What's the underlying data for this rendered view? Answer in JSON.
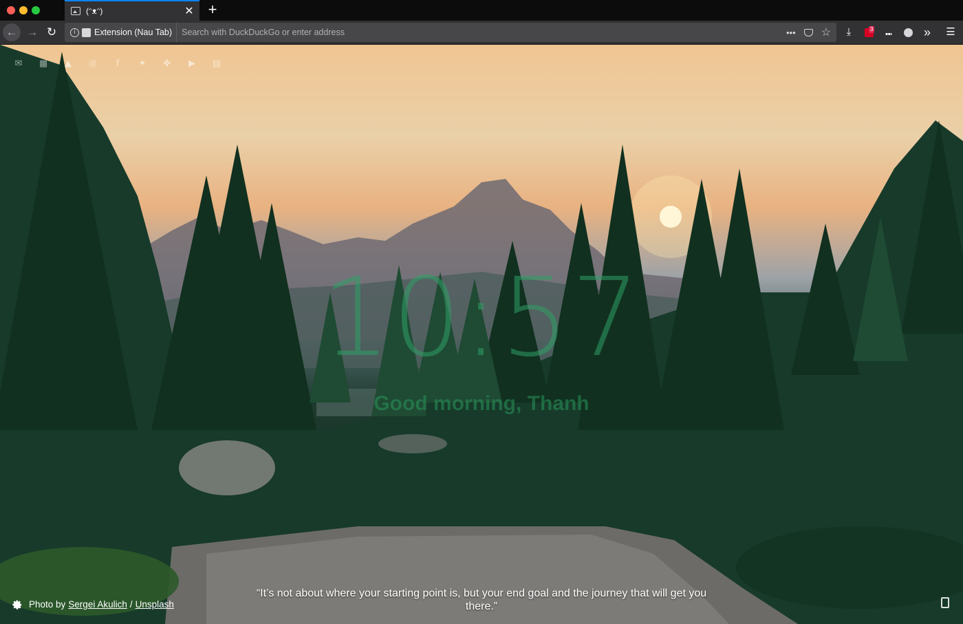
{
  "tab": {
    "title": "(ᵔᴥᵔ)",
    "close_symbol": "✕",
    "new_tab_symbol": "+"
  },
  "navbar": {
    "identity_label": "Extension (Nau Tab)",
    "url_placeholder": "Search with DuckDuckGo or enter address",
    "page_actions_symbol": "•••",
    "bookmark_symbol": "☆",
    "download_symbol": "⤓",
    "extension_badge": "3",
    "library_symbol": "⑉",
    "overflow_symbol": "»",
    "menu_symbol": "☰",
    "back_symbol": "←",
    "forward_symbol": "→",
    "reload_symbol": "↻"
  },
  "shortcuts": [
    {
      "name": "gmail-icon",
      "glyph": "✉"
    },
    {
      "name": "calendar-icon",
      "glyph": "▦"
    },
    {
      "name": "drive-icon",
      "glyph": "▲"
    },
    {
      "name": "github-icon",
      "glyph": "◎"
    },
    {
      "name": "facebook-icon",
      "glyph": "f"
    },
    {
      "name": "twitter-icon",
      "glyph": "✦"
    },
    {
      "name": "pinwheel-icon",
      "glyph": "✤"
    },
    {
      "name": "youtube-icon",
      "glyph": "▶"
    },
    {
      "name": "news-icon",
      "glyph": "▤"
    }
  ],
  "main": {
    "clock": "10:57",
    "greeting": "Good morning, Thanh"
  },
  "footer": {
    "photo_by": "Photo by",
    "photographer": "Sergei Akulich",
    "separator": "/",
    "source": "Unsplash",
    "quote": "“It’s not about where your starting point is, but your end goal and the journey that will get you there.”"
  },
  "colors": {
    "accent_tab": "#0a84ff",
    "clock_green": "#2ea066"
  }
}
